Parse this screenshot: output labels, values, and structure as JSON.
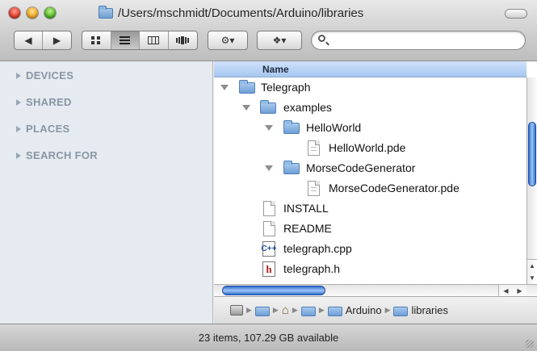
{
  "window": {
    "title": "/Users/mschmidt/Documents/Arduino/libraries"
  },
  "toolbar": {
    "back_icon": "◀",
    "forward_icon": "▶",
    "view_icons": [
      "icon-view-icon",
      "list-view-icon",
      "column-view-icon",
      "cover-flow-icon"
    ],
    "action_label": "⚙▾",
    "dropbox_label": "❖▾",
    "search_placeholder": ""
  },
  "sidebar": {
    "sections": [
      "DEVICES",
      "SHARED",
      "PLACES",
      "SEARCH FOR"
    ]
  },
  "list": {
    "column_header": "Name",
    "rows": [
      {
        "label": "Telegraph",
        "type": "folder",
        "expanded": true,
        "depth": 0
      },
      {
        "label": "examples",
        "type": "folder",
        "expanded": true,
        "depth": 1
      },
      {
        "label": "HelloWorld",
        "type": "folder",
        "expanded": true,
        "depth": 2
      },
      {
        "label": "HelloWorld.pde",
        "type": "document",
        "depth": 3
      },
      {
        "label": "MorseCodeGenerator",
        "type": "folder",
        "expanded": true,
        "depth": 2
      },
      {
        "label": "MorseCodeGenerator.pde",
        "type": "document",
        "depth": 3
      },
      {
        "label": "INSTALL",
        "type": "file",
        "depth": 1
      },
      {
        "label": "README",
        "type": "file",
        "depth": 1
      },
      {
        "label": "telegraph.cpp",
        "type": "cpp",
        "badge": "C++",
        "depth": 1
      },
      {
        "label": "telegraph.h",
        "type": "header",
        "badge": "h",
        "depth": 1
      }
    ]
  },
  "pathbar": {
    "items": [
      "Arduino",
      "libraries"
    ]
  },
  "status": {
    "text": "23 items, 107.29 GB available"
  }
}
